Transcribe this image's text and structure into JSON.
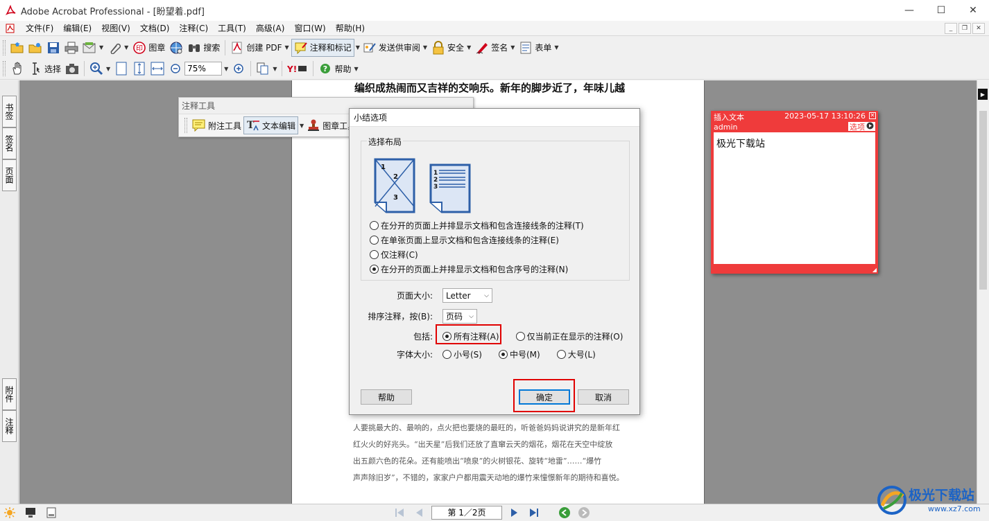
{
  "window": {
    "title": "Adobe Acrobat Professional - [盼望着.pdf]",
    "controls": [
      "—",
      "☐",
      "✕"
    ]
  },
  "menu": [
    "文件(F)",
    "编辑(E)",
    "视图(V)",
    "文档(D)",
    "注释(C)",
    "工具(T)",
    "高级(A)",
    "窗口(W)",
    "帮助(H)"
  ],
  "toolbar1": {
    "stamp": "图章",
    "search": "搜索",
    "create_pdf": "创建 PDF",
    "comment_markup": "注释和标记",
    "send_review": "发送供审阅",
    "security": "安全",
    "sign": "签名",
    "forms": "表单"
  },
  "toolbar2": {
    "select": "选择",
    "zoom": "75%",
    "help": "帮助"
  },
  "left_tabs": {
    "bookmarks": "书签",
    "signatures": "签名",
    "pages": "页面",
    "attachments": "附件",
    "comments": "注释"
  },
  "comment_toolbar": {
    "title": "注释工具",
    "note_tool": "附注工具",
    "text_edit": "文本编辑",
    "stamp_tool": "图章工具"
  },
  "document": {
    "heading": "编织成热闹而又吉祥的交响乐。新年的脚步近了，年味儿越",
    "lines": [
      "人要挑最大的、最响的，点火把也要烧的最旺的，听爸爸妈妈说讲究的是新年红",
      "红火火的好兆头。“出天星”后我们还放了直窜云天的烟花，烟花在天空中绽放",
      "出五颜六色的花朵。还有能喷出“喷泉”的火树银花、旋转“地雷”……“爆竹",
      "声声除旧岁”，不错的，家家户户都用震天动地的爆竹来憧憬新年的期待和喜悦。"
    ]
  },
  "dialog": {
    "title": "小结选项",
    "group_label": "选择布局",
    "layout_options": [
      "在分开的页面上并排显示文档和包含连接线条的注释(T)",
      "在单张页面上显示文档和包含连接线条的注释(E)",
      "仅注释(C)",
      "在分开的页面上并排显示文档和包含序号的注释(N)"
    ],
    "selected_layout_index": 3,
    "page_size_label": "页面大小:",
    "page_size_value": "Letter",
    "sort_label": "排序注释，按(B):",
    "sort_value": "页码",
    "include_label": "包括:",
    "include_all": "所有注释(A)",
    "include_current": "仅当前正在显示的注释(O)",
    "font_label": "字体大小:",
    "font_small": "小号(S)",
    "font_medium": "中号(M)",
    "font_large": "大号(L)",
    "help_button": "帮助",
    "ok_button": "确定",
    "cancel_button": "取消"
  },
  "note": {
    "type": "插入文本",
    "timestamp": "2023-05-17 13:10:26",
    "author": "admin",
    "options": "选项",
    "content": "极光下载站"
  },
  "statusbar": {
    "page": "第 1／2页"
  },
  "watermark": {
    "text": "极光下载站",
    "url": "www.xz7.com"
  },
  "colors": {
    "note_red": "#ef3b3b",
    "highlight_red": "#e00000",
    "workspace_gray": "#8e8e8e",
    "default_button_blue": "#0078d7"
  }
}
